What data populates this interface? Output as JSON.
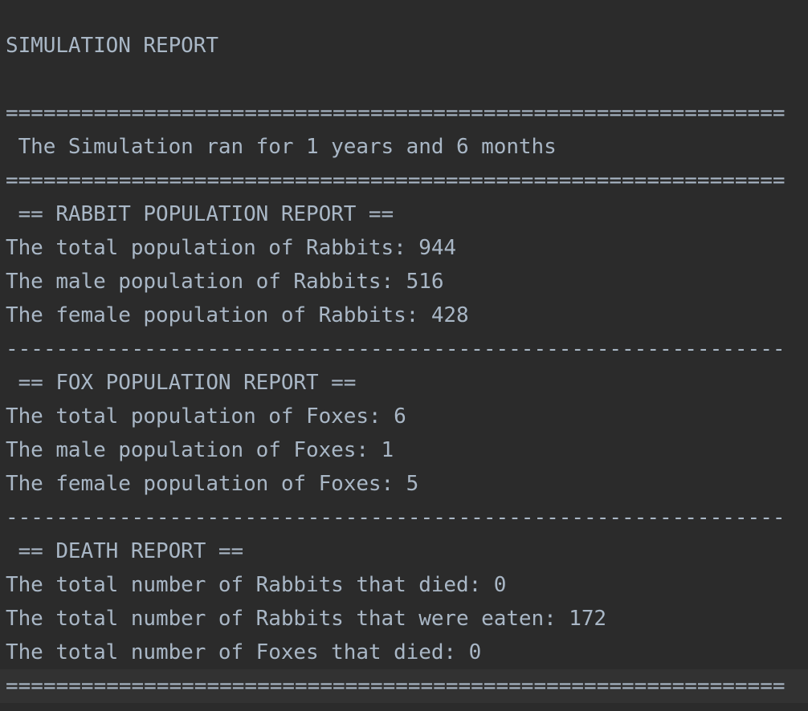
{
  "console": {
    "title": "SIMULATION REPORT",
    "separator_double": "==============================================================",
    "separator_single": "--------------------------------------------------------------",
    "duration": " The Simulation ran for 1 years and 6 months",
    "rabbit": {
      "heading": " == RABBIT POPULATION REPORT ==",
      "total": "The total population of Rabbits: 944",
      "male": "The male population of Rabbits: 516",
      "female": "The female population of Rabbits: 428"
    },
    "fox": {
      "heading": " == FOX POPULATION REPORT ==",
      "total": "The total population of Foxes: 6",
      "male": "The male population of Foxes: 1",
      "female": "The female population of Foxes: 5"
    },
    "death": {
      "heading": " == DEATH REPORT ==",
      "rabbits_died": "The total number of Rabbits that died: 0",
      "rabbits_eaten": "The total number of Rabbits that were eaten: 172",
      "foxes_died": "The total number of Foxes that died: 0"
    }
  },
  "colors": {
    "background": "#2b2b2b",
    "text": "#a9b7c6",
    "caret_row": "#323232"
  }
}
